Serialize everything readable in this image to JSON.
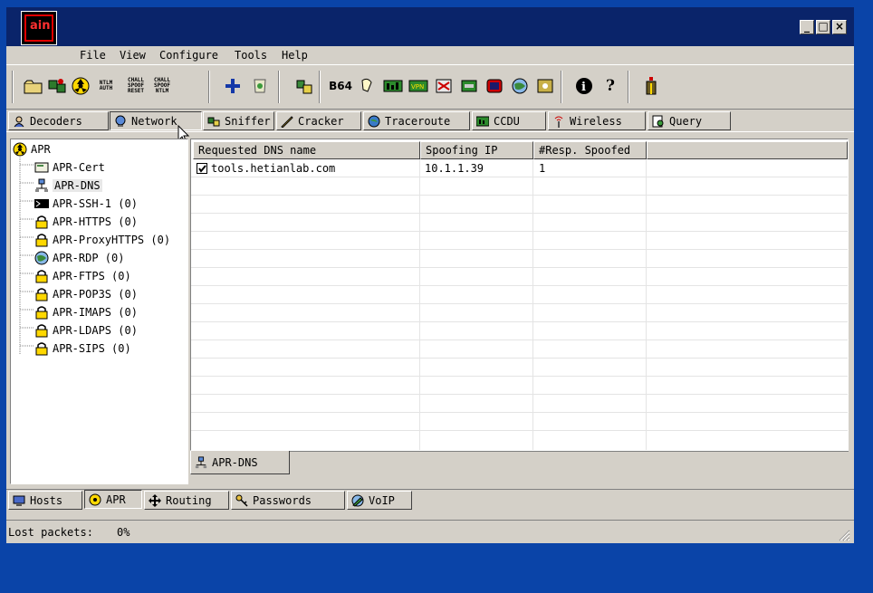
{
  "app": {
    "icon_text": "ain"
  },
  "window_buttons": {
    "minimize": "_",
    "maximize": "□",
    "close": "×"
  },
  "menu": [
    "File",
    "View",
    "Configure",
    "Tools",
    "Help"
  ],
  "toolbar": {
    "ntlm_auth": [
      "NTLM",
      "AUTH"
    ],
    "chall_spoof_reset": [
      "CHALL",
      "SPOOF",
      "RESET"
    ],
    "chall_spoof_ntlm": [
      "CHALL",
      "SPOOF",
      "NTLM"
    ],
    "b64": "B64",
    "help": "?"
  },
  "tabs": [
    {
      "label": "Decoders"
    },
    {
      "label": "Network"
    },
    {
      "label": "Sniffer"
    },
    {
      "label": "Cracker"
    },
    {
      "label": "Traceroute"
    },
    {
      "label": "CCDU"
    },
    {
      "label": "Wireless"
    },
    {
      "label": "Query"
    }
  ],
  "tree": {
    "root": "APR",
    "items": [
      "APR-Cert",
      "APR-DNS",
      "APR-SSH-1  (0)",
      "APR-HTTPS  (0)",
      "APR-ProxyHTTPS  (0)",
      "APR-RDP  (0)",
      "APR-FTPS  (0)",
      "APR-POP3S  (0)",
      "APR-IMAPS  (0)",
      "APR-LDAPS  (0)",
      "APR-SIPS  (0)"
    ]
  },
  "table": {
    "columns": [
      "Requested DNS name",
      "Spoofing IP",
      "#Resp. Spoofed"
    ],
    "rows": [
      {
        "dns": "tools.hetianlab.com",
        "ip": "10.1.1.39",
        "count": "1"
      }
    ]
  },
  "subtab": {
    "label": "APR-DNS"
  },
  "bottom_tabs": [
    "Hosts",
    "APR",
    "Routing",
    "Passwords",
    "VoIP"
  ],
  "status": {
    "label": "Lost packets:",
    "value": "0%"
  },
  "colors": {
    "desktop": "#0a44a8",
    "title": "#0a246a",
    "face": "#d4d0c8",
    "accent": "#e00000"
  }
}
